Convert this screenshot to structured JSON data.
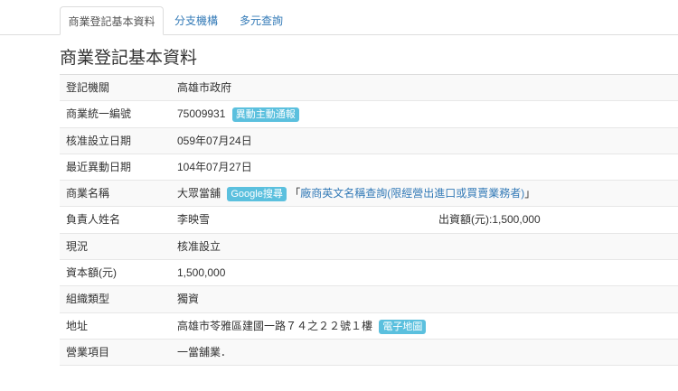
{
  "tabs": [
    {
      "label": "商業登記基本資料"
    },
    {
      "label": "分支機構"
    },
    {
      "label": "多元查詢"
    }
  ],
  "title": "商業登記基本資料",
  "rows": [
    {
      "label": "登記機關",
      "value": "高雄市政府"
    },
    {
      "label": "商業統一編號",
      "value": "75009931",
      "badge": "異動主動通報"
    },
    {
      "label": "核准設立日期",
      "value": "059年07月24日"
    },
    {
      "label": "最近異動日期",
      "value": "104年07月27日"
    },
    {
      "label": "商業名稱",
      "value": "大眾當舖",
      "badge": "Google搜尋",
      "bracket_open": "「",
      "link": "廠商英文名稱查詢(限經營出進口或買賣業務者)",
      "bracket_close": "」"
    },
    {
      "label": "負責人姓名",
      "value": "李映雪",
      "extra": "出資額(元):1,500,000"
    },
    {
      "label": "現況",
      "value": "核准設立"
    },
    {
      "label": "資本額(元)",
      "value": "1,500,000"
    },
    {
      "label": "組織類型",
      "value": "獨資"
    },
    {
      "label": "地址",
      "value": "高雄市苓雅區建國一路７４之２２號１樓",
      "badge": "電子地圖"
    },
    {
      "label": "營業項目",
      "value": "一當舖業．"
    }
  ],
  "colors": {
    "accent": "#337ab7",
    "badge": "#5bc0de",
    "stripe": "#f9f9f9"
  }
}
